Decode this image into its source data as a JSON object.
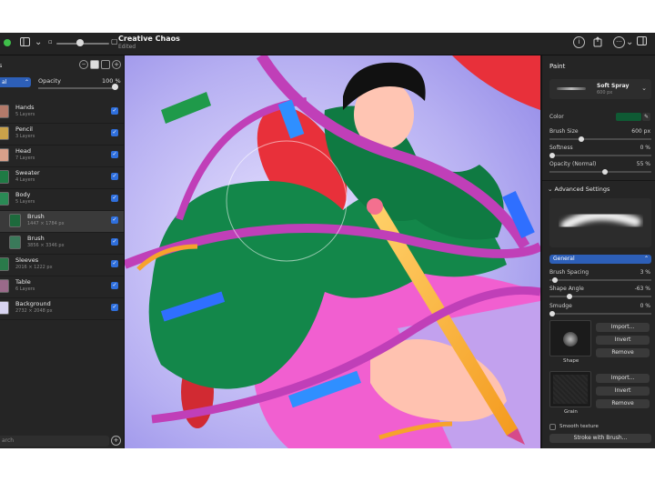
{
  "document": {
    "title": "Creative Chaos",
    "status": "Edited"
  },
  "left_panel": {
    "opacity_label": "Opacity",
    "opacity_value": "100 %",
    "opacity_fraction": 1.0,
    "blend_mode": "al",
    "header_label": "s",
    "layers": [
      {
        "name": "Hands",
        "info": "5 Layers",
        "selected": false,
        "visible": true
      },
      {
        "name": "Pencil",
        "info": "3 Layers",
        "selected": false,
        "visible": true
      },
      {
        "name": "Head",
        "info": "7 Layers",
        "selected": false,
        "visible": true
      },
      {
        "name": "Sweater",
        "info": "4 Layers",
        "selected": false,
        "visible": true
      },
      {
        "name": "Body",
        "info": "5 Layers",
        "selected": false,
        "visible": true
      },
      {
        "name": "Brush",
        "info": "1447 × 1784 px",
        "selected": true,
        "visible": true
      },
      {
        "name": "Brush",
        "info": "3856 × 3346 px",
        "selected": false,
        "visible": true
      },
      {
        "name": "Sleeves",
        "info": "2016 × 1222 px",
        "selected": false,
        "visible": true
      },
      {
        "name": "Table",
        "info": "6 Layers",
        "selected": false,
        "visible": true
      },
      {
        "name": "Background",
        "info": "2732 × 2048 px",
        "selected": false,
        "visible": true
      }
    ],
    "search_placeholder": "arch"
  },
  "right_panel": {
    "title": "Paint",
    "brush_name": "Soft Spray",
    "brush_size_label": "600 px",
    "color_label": "Color",
    "color_value": "#0f5a34",
    "brush_size": {
      "label": "Brush Size",
      "value": "600 px",
      "fraction": 0.3
    },
    "softness": {
      "label": "Softness",
      "value": "0 %",
      "fraction": 0.0
    },
    "opacity": {
      "label": "Opacity (Normal)",
      "value": "55 %",
      "fraction": 0.55
    },
    "advanced_label": "Advanced Settings",
    "general_option": "General",
    "brush_spacing": {
      "label": "Brush Spacing",
      "value": "3 %",
      "fraction": 0.03
    },
    "shape_angle": {
      "label": "Shape Angle",
      "value": "-63 %",
      "fraction": 0.18
    },
    "smudge": {
      "label": "Smudge",
      "value": "0 %",
      "fraction": 0.0
    },
    "shape_label": "Shape",
    "grain_label": "Grain",
    "import_label": "Import...",
    "invert_label": "Invert",
    "remove_label": "Remove",
    "smooth_label": "Smooth texture",
    "stroke_label": "Stroke with Brush..."
  }
}
